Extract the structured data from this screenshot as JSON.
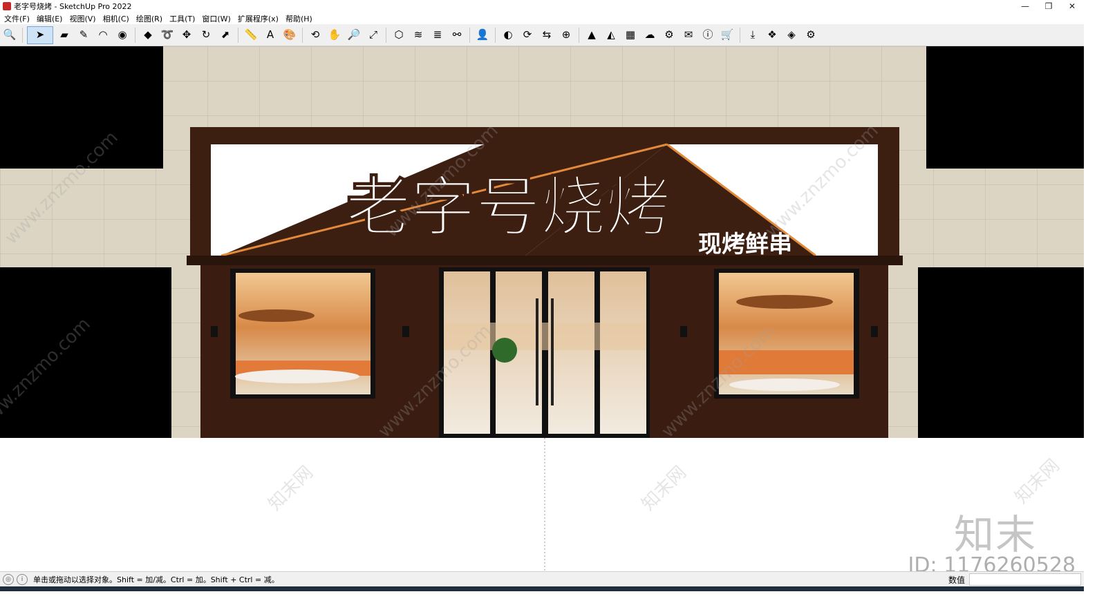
{
  "window": {
    "title": "老字号烧烤 - SketchUp Pro 2022",
    "minimize": "—",
    "restore": "❐",
    "close": "✕"
  },
  "menu": [
    "文件(F)",
    "编辑(E)",
    "视图(V)",
    "相机(C)",
    "绘图(R)",
    "工具(T)",
    "窗口(W)",
    "扩展程序(x)",
    "帮助(H)"
  ],
  "toolbar": {
    "icons": [
      {
        "name": "zoom-icon",
        "glyph": "🔍"
      },
      {
        "name": "select-arrow-icon",
        "glyph": "➤"
      },
      {
        "name": "eraser-icon",
        "glyph": "▰"
      },
      {
        "name": "pencil-icon",
        "glyph": "✎"
      },
      {
        "name": "arc-icon",
        "glyph": "◠"
      },
      {
        "name": "circle-icon",
        "glyph": "◉"
      },
      {
        "name": "push-pull-icon",
        "glyph": "◆"
      },
      {
        "name": "follow-me-icon",
        "glyph": "➰"
      },
      {
        "name": "move-icon",
        "glyph": "✥"
      },
      {
        "name": "rotate-icon",
        "glyph": "↻"
      },
      {
        "name": "scale-icon",
        "glyph": "⬈"
      },
      {
        "name": "tape-measure-icon",
        "glyph": "📏"
      },
      {
        "name": "text-icon",
        "glyph": "A"
      },
      {
        "name": "paint-bucket-icon",
        "glyph": "🎨"
      },
      {
        "name": "orbit-icon",
        "glyph": "⟲"
      },
      {
        "name": "pan-icon",
        "glyph": "✋"
      },
      {
        "name": "zoom-window-icon",
        "glyph": "🔎"
      },
      {
        "name": "zoom-extents-icon",
        "glyph": "⤢"
      },
      {
        "name": "components-icon",
        "glyph": "⬡"
      },
      {
        "name": "layers-icon",
        "glyph": "≋"
      },
      {
        "name": "styles-icon",
        "glyph": "≣"
      },
      {
        "name": "tags-icon",
        "glyph": "⚯"
      },
      {
        "name": "account-icon",
        "glyph": "👤"
      },
      {
        "name": "extension-warehouse-icon",
        "glyph": "◐"
      },
      {
        "name": "sync-icon",
        "glyph": "⟳"
      },
      {
        "name": "send-layout-icon",
        "glyph": "⇆"
      },
      {
        "name": "add-icon",
        "glyph": "⊕"
      },
      {
        "name": "tree-icon",
        "glyph": "▲"
      },
      {
        "name": "terrain-icon",
        "glyph": "◭"
      },
      {
        "name": "checker-icon",
        "glyph": "▦"
      },
      {
        "name": "cloud-upload-icon",
        "glyph": "☁"
      },
      {
        "name": "settings-gears-icon",
        "glyph": "⚙"
      },
      {
        "name": "mail-icon",
        "glyph": "✉"
      },
      {
        "name": "info-icon",
        "glyph": "ⓘ"
      },
      {
        "name": "cart-icon",
        "glyph": "🛒"
      },
      {
        "name": "download-icon",
        "glyph": "⤓"
      },
      {
        "name": "stack-icon",
        "glyph": "❖"
      },
      {
        "name": "ruby-icon",
        "glyph": "◈"
      },
      {
        "name": "gear-icon",
        "glyph": "⚙"
      }
    ]
  },
  "scene": {
    "sign_main": "老字号烧烤",
    "sign_sub": "现烤鲜串",
    "colors": {
      "facade": "#3d1f12",
      "wall": "#ddd5c4",
      "accent": "#e28a3a",
      "glass": "#d08a4a"
    }
  },
  "watermarks": {
    "site": "www.znzmo.com",
    "logo": "知末网",
    "brand": "知末",
    "id": "ID: 1176260528"
  },
  "status": {
    "hint": "单击或拖动以选择对象。Shift = 加/减。Ctrl = 加。Shift + Ctrl = 减。",
    "value_label": "数值"
  }
}
